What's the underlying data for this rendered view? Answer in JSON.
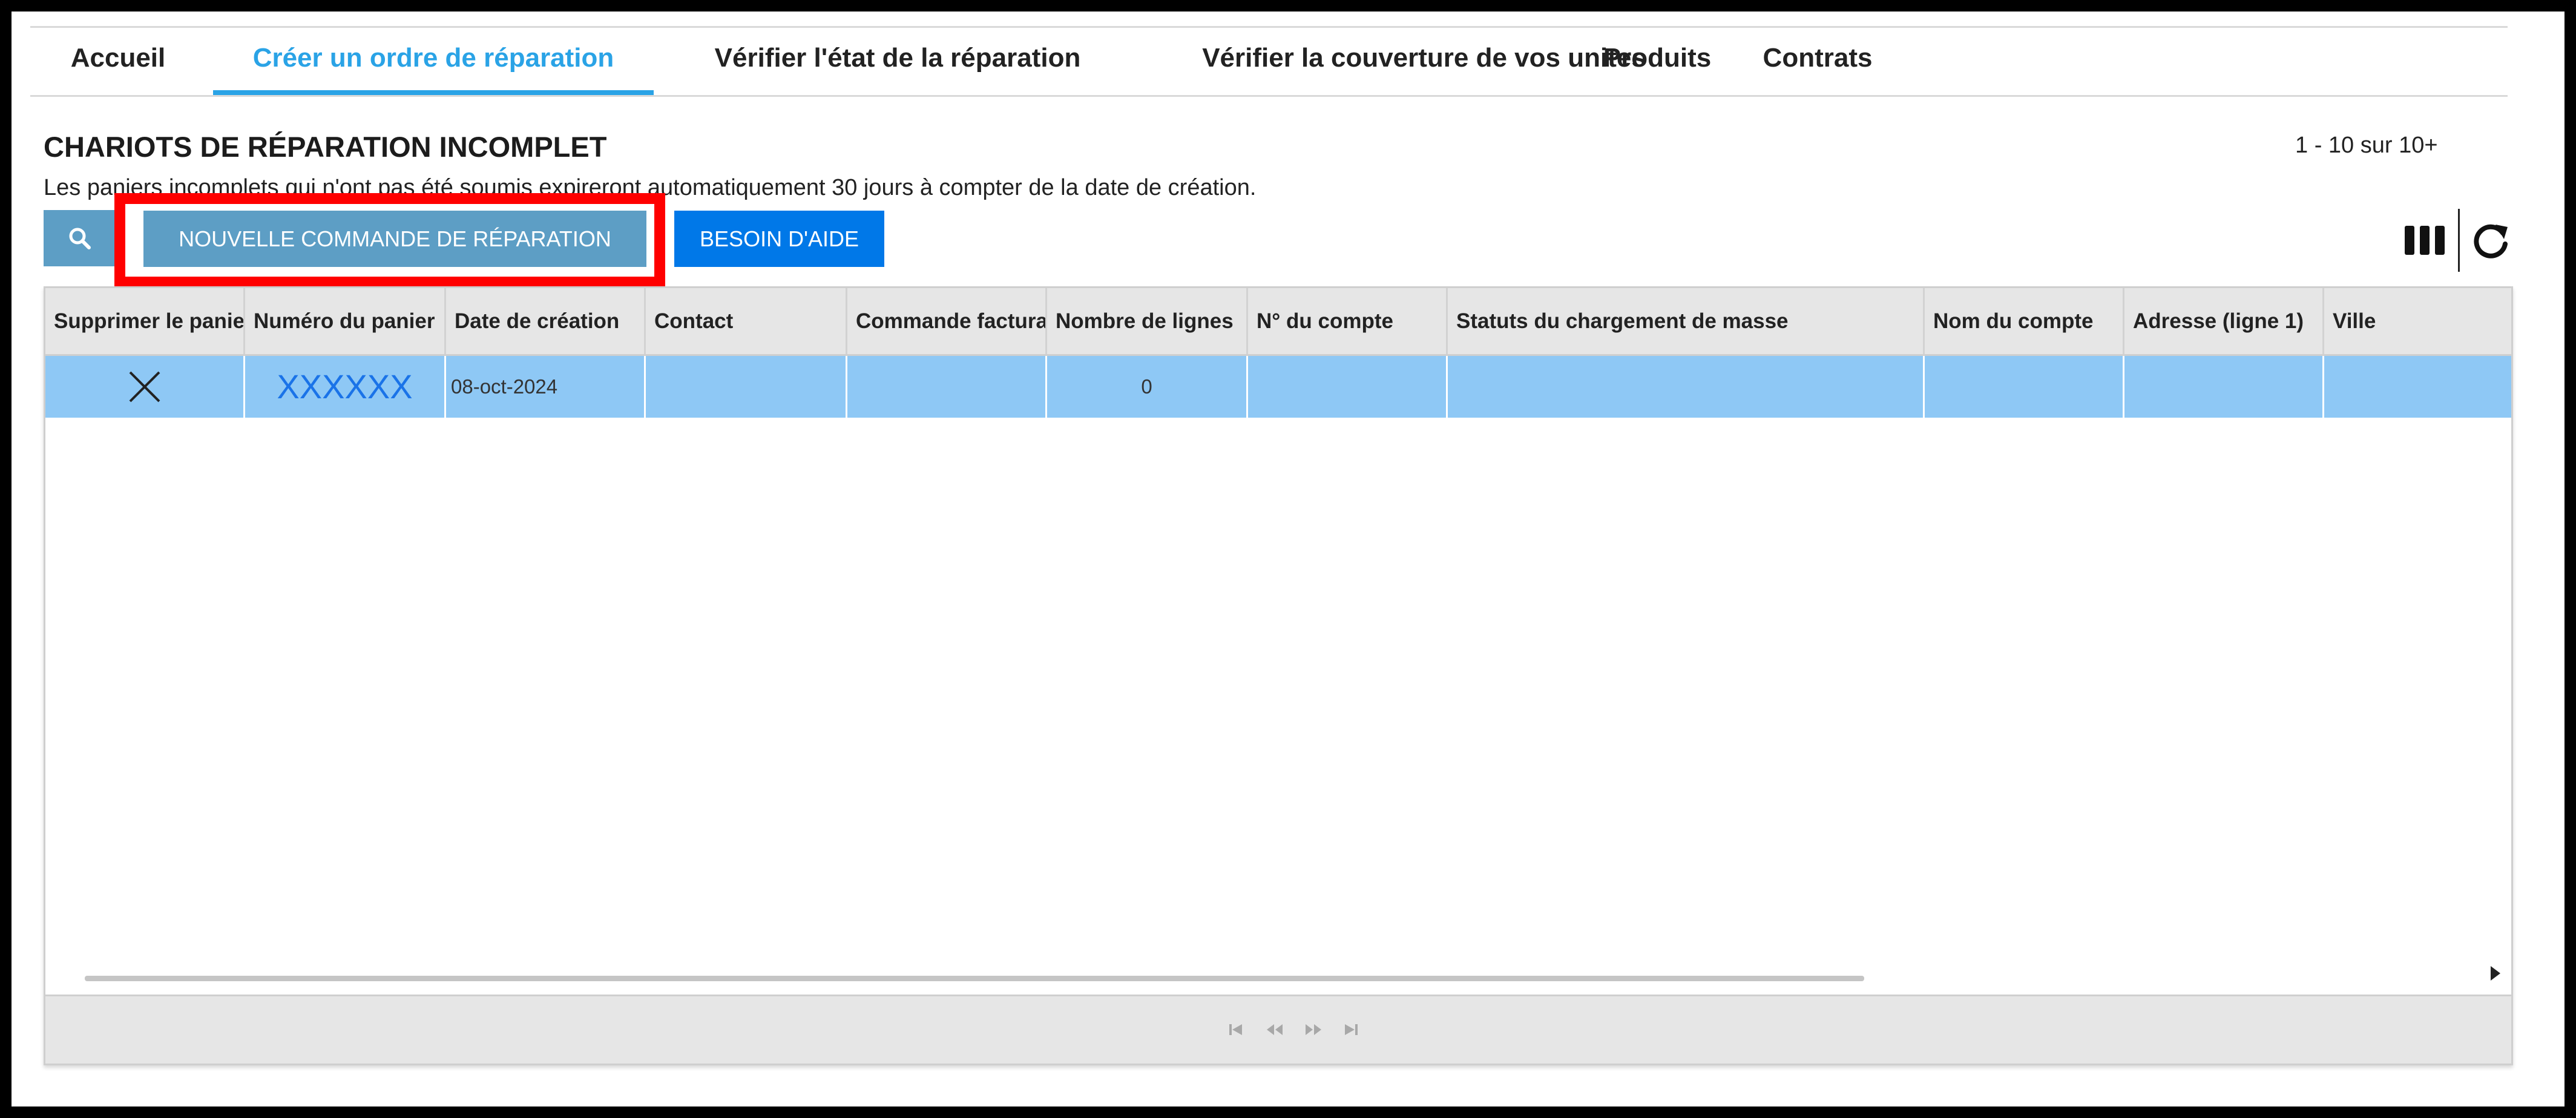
{
  "nav": {
    "tabs": [
      {
        "label": "Accueil",
        "active": false
      },
      {
        "label": "Créer un ordre de réparation",
        "active": true
      },
      {
        "label": "Vérifier l'état de la réparation",
        "active": false
      },
      {
        "label": "Vérifier la couverture de vos unites",
        "active": false
      },
      {
        "label": "Produits",
        "active": false
      },
      {
        "label": "Contrats",
        "active": false
      }
    ]
  },
  "page": {
    "title": "CHARIOTS DE RÉPARATION INCOMPLET",
    "subtitle": "Les paniers incomplets qui n'ont pas été soumis expireront automatiquement 30 jours à compter de la date de création.",
    "pager_info": "1 - 10 sur 10+"
  },
  "toolbar": {
    "search_icon": "search-icon",
    "new_order_label": "NOUVELLE COMMANDE DE RÉPARATION",
    "help_label": "BESOIN D'AIDE",
    "columns_icon": "columns-icon",
    "refresh_icon": "refresh-icon",
    "highlight_color": "#ff0000"
  },
  "grid": {
    "columns": [
      "Supprimer le panier",
      "Numéro du panier",
      "Date de création",
      "Contact",
      "Commande facturable",
      "Nombre de lignes",
      "N° du compte",
      "Statuts du chargement de masse",
      "Nom du compte",
      "Adresse (ligne 1)",
      "Ville"
    ],
    "rows": [
      {
        "delete_icon": "close-icon",
        "cart_number": "XXXXXX",
        "created": "08-oct-2024",
        "contact": "",
        "billable_order": "",
        "line_count": "0",
        "account_number": "",
        "bulk_status": "",
        "account_name": "",
        "address_1": "",
        "city": ""
      }
    ],
    "selected_row_color": "#8ec8f5",
    "link_color": "#1a73e8",
    "footer_icons": [
      "first-page-icon",
      "previous-page-icon",
      "next-page-icon",
      "last-page-icon"
    ]
  }
}
